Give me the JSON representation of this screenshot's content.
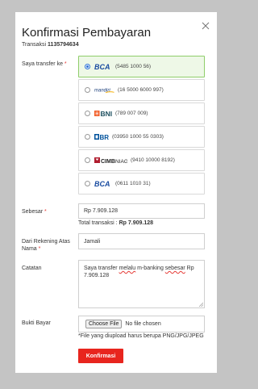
{
  "dialog": {
    "title": "Konfirmasi Pembayaran",
    "transaction_label": "Transaksi",
    "transaction_id": "1135794634"
  },
  "transfer": {
    "label": "Saya transfer ke",
    "required_mark": "*",
    "selected_bank": "BCA",
    "banks": [
      {
        "name": "BCA",
        "account": "(5485 1000 56)",
        "selected": true
      },
      {
        "name": "mandiri",
        "account": "(16 5000 6000 997)",
        "selected": false
      },
      {
        "name": "BNI",
        "account": "(789 007 009)",
        "selected": false
      },
      {
        "name": "BRI",
        "account": "(03950 1000 55 0303)",
        "selected": false
      },
      {
        "name": "CIMB NIAGA",
        "account": "(9410 10000 8192)",
        "selected": false
      },
      {
        "name": "BCA",
        "account": "(0611 1010 31)",
        "selected": false
      }
    ]
  },
  "amount": {
    "label": "Sebesar",
    "required_mark": "*",
    "value": "Rp 7.909.128",
    "total_label": "Total transaksi :",
    "total_value": "Rp 7.909.128"
  },
  "sender": {
    "label_line1": "Dari Rekening Atas",
    "label_line2": "Nama",
    "required_mark": "*",
    "value": "Jamali"
  },
  "notes": {
    "label": "Catatan",
    "parts": [
      "Saya transfer ",
      "melalu",
      " m-banking ",
      "sebesar",
      " Rp",
      "7.909.128"
    ]
  },
  "proof": {
    "label": "Bukti Bayar",
    "button_label": "Choose File",
    "status": "No file chosen",
    "hint": "*File yang diupload harus berupa PNG/JPG/JPEG"
  },
  "submit_label": "Konfirmasi",
  "colors": {
    "accent": "#e8251e",
    "selected_bg": "#eef8e7",
    "selected_border": "#8fcd6a",
    "bca_blue": "#1b4da1",
    "bni_orange": "#f15a23",
    "bri_blue": "#00529c",
    "cimb_red": "#b01c2e",
    "mandiri_yellow": "#f6b923"
  }
}
